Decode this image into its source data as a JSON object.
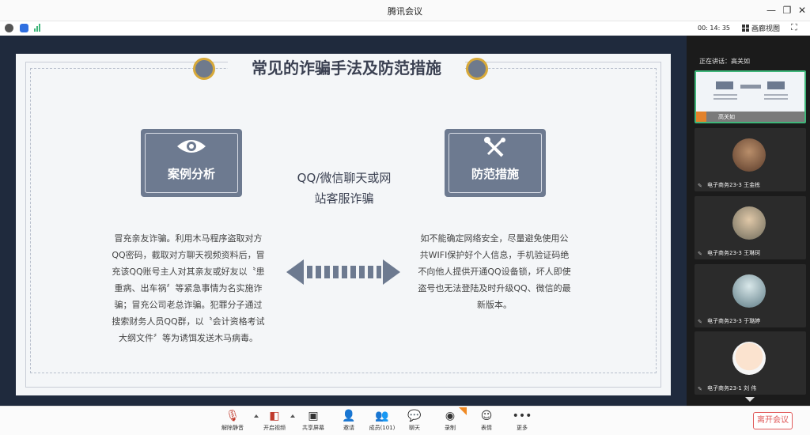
{
  "window": {
    "title": "腾讯会议"
  },
  "infobar": {
    "timer": "00: 14: 35",
    "view_label": "画廊视图"
  },
  "slide": {
    "title": "常见的诈骗手法及防范措施",
    "left_card": "案例分析",
    "right_card": "防范措施",
    "mid_line1": "QQ/微信聊天或网",
    "mid_line2": "站客服诈骗",
    "left_lines": [
      "冒充亲友诈骗。利用木马程序盗取对方",
      "QQ密码，截取对方聊天视频资料后，冒",
      "充该QQ账号主人对其亲友或好友以〝患",
      "重病、出车祸〞等紧急事情为名实施诈",
      "骗；冒充公司老总诈骗。犯罪分子通过",
      "搜索财务人员QQ群，以〝会计资格考试",
      "大纲文件〞等为诱饵发送木马病毒。"
    ],
    "right_lines": [
      "如不能确定网络安全，尽量避免使用公",
      "共WIFI保护好个人信息，手机验证码绝",
      "不向他人提供开通QQ设备锁，坏人即使",
      "盗号也无法登陆及时升级QQ、微信的最",
      "新版本。"
    ]
  },
  "panel": {
    "speaking": "正在讲话：高关如",
    "active_name": "高关如",
    "participants": [
      {
        "name": "电子商务23-3 王金栋"
      },
      {
        "name": "电子商务23-3 王琳珂"
      },
      {
        "name": "电子商务23-3 于璐婷"
      },
      {
        "name": "电子商务23-1 刘 伟"
      }
    ]
  },
  "toolbar": {
    "unmute": "解除静音",
    "video": "开启视频",
    "share": "共享屏幕",
    "invite": "邀请",
    "members": "成员(101)",
    "chat": "聊天",
    "record": "录制",
    "emoji": "表情",
    "more": "更多",
    "leave": "离开会议"
  },
  "colors": {
    "accent_green": "#3fb67a",
    "leave_red": "#e05a5a",
    "card_slate": "#6d7a90",
    "gold": "#d7a93a"
  }
}
